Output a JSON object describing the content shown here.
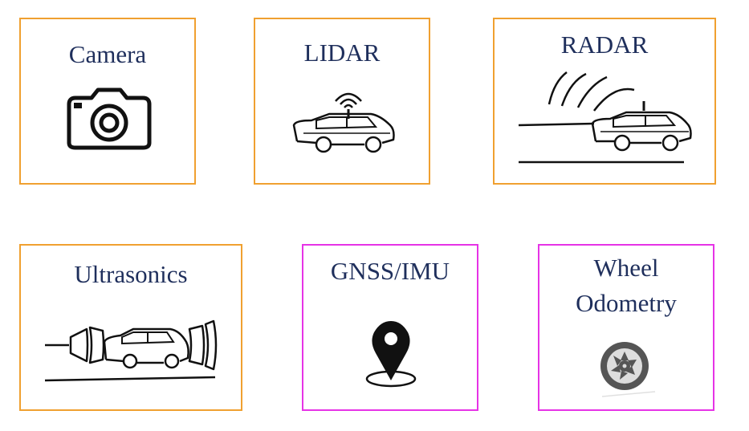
{
  "sensors": [
    {
      "label": "Camera",
      "icon": "camera-icon",
      "group": "perception"
    },
    {
      "label": "LIDAR",
      "icon": "lidar-car-icon",
      "group": "perception"
    },
    {
      "label": "RADAR",
      "icon": "radar-car-icon",
      "group": "perception"
    },
    {
      "label": "Ultrasonics",
      "icon": "ultrasonic-car-icon",
      "group": "perception"
    },
    {
      "label": "GNSS/IMU",
      "icon": "location-pin-icon",
      "group": "localization"
    },
    {
      "label_line1": "Wheel",
      "label_line2": "Odometry",
      "icon": "wheel-icon",
      "group": "localization"
    }
  ],
  "colors": {
    "perception_border": "#f0a030",
    "localization_border": "#e633e6",
    "label_text": "#1f2f5c"
  }
}
